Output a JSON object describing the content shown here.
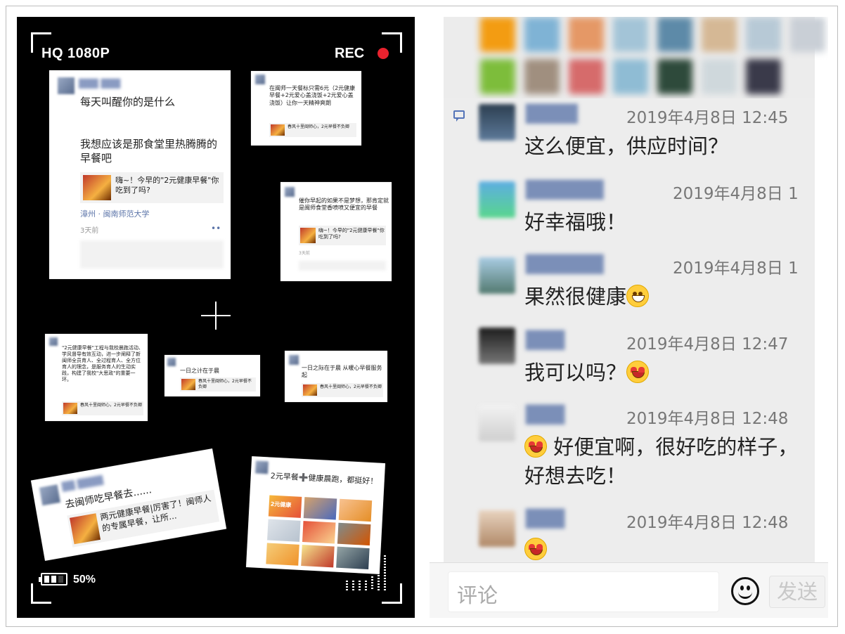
{
  "camera": {
    "quality": "HQ 1080P",
    "rec_label": "REC",
    "battery_label": "50%",
    "battery_level": 0.5
  },
  "cards": {
    "card1": {
      "line1": "每天叫醒你的是什么",
      "line2": "我想应该是那食堂里热腾腾的早餐吧",
      "link": "嗨~！今早的\"2元健康早餐\"你吃到了吗?",
      "location": "漳州 · 闽南师范大学",
      "time": "3天前"
    },
    "card2": {
      "text": "在闽师一天餐标只需6元（2元健康早餐+2元爱心盖浇饭+2元爱心盖浇饭）让你一天精神爽朗",
      "link": "春风十里闽师心，2元早餐不负卿"
    },
    "card3": {
      "text": "催你早起的如果不是梦想，那肯定就是闽师食堂香喷喷又便宜的早餐",
      "link": "嗨~！今早的\"2元健康早餐\"你吃到了吗?",
      "time": "3天前"
    },
    "card4": {
      "text": "\"2元健康早餐\"工程与我校晨跑活动、学风督导有效互动，进一步阐释了新闽师全员育人、全过程育人、全方位育人的理念，是服务育人的生动实践，构建了我校\"大思政\"的重要一环。",
      "link": "春风十里闽师心，2元早餐不负卿"
    },
    "card5": {
      "text": "一日之计在于晨",
      "link": "春风十里闽师心，2元早餐不负卿"
    },
    "card6": {
      "text": "一日之际在于晨 从暖心早餐服务起",
      "link": "春风十里闽师心，2元早餐不负卿"
    },
    "card7": {
      "text": "去闽师吃早餐去......",
      "link": "两元健康早餐|厉害了！闽师人的专属早餐，让所..."
    },
    "card8": {
      "text": "2元早餐➕健康晨跑，都挺好！",
      "photo_label": "2元健康"
    }
  },
  "comments": [
    {
      "time": "2019年4月8日 12:45",
      "text": "这么便宜，供应时间？",
      "emoji": ""
    },
    {
      "time": "2019年4月8日 1",
      "text": "好幸福哦！",
      "emoji": ""
    },
    {
      "time": "2019年4月8日 1",
      "text": "果然很健康",
      "emoji": "grin"
    },
    {
      "time": "2019年4月8日 12:47",
      "text": "我可以吗？",
      "emoji": "heart-eyes"
    },
    {
      "time": "2019年4月8日 12:48",
      "text": "好便宜啊，很好吃的样子，好想去吃！",
      "emoji": "heart-eyes"
    },
    {
      "time": "2019年4月8日 12:48",
      "text": "",
      "emoji": "heart-eyes"
    }
  ],
  "comment_bar": {
    "placeholder": "评论",
    "send_label": "发送"
  },
  "colors": {
    "rec": "#e8222e",
    "link_name": "#7b8fb8",
    "chat_bg": "#ededed"
  }
}
